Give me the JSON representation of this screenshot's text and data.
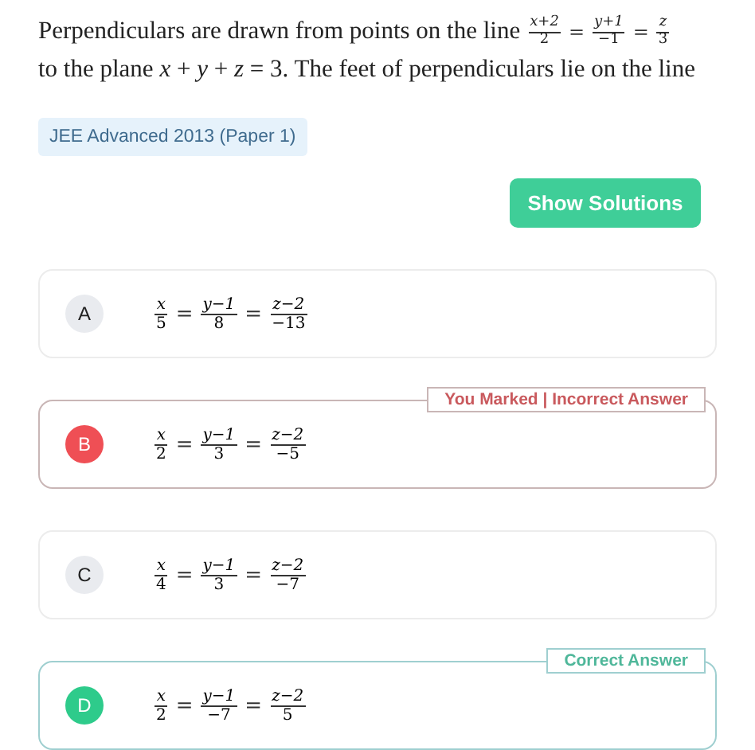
{
  "question": {
    "line_1": "Perpendiculars are drawn from points on the line",
    "line_1_equation": {
      "sign": "=",
      "fractions": [
        {
          "num": "x+2",
          "den": "2"
        },
        {
          "num": "y+1",
          "den": "−1"
        },
        {
          "num": "z",
          "den": "3"
        }
      ]
    },
    "line_2": "to the plane *x* + *y* + *z* = 3. The feet of perpendiculars lie on the line"
  },
  "tag": "JEE Advanced 2013 (Paper 1)",
  "show_solutions_button": "Show Solutions",
  "options": [
    {
      "letter": "A",
      "marked": false,
      "correct": false,
      "equation": {
        "sign": "=",
        "fractions": [
          {
            "num": "x",
            "den": "5"
          },
          {
            "num": "y−1",
            "den": "8"
          },
          {
            "num": "z−2",
            "den": "−13"
          }
        ]
      }
    },
    {
      "letter": "B",
      "marked": true,
      "correct": false,
      "badge": "You Marked | Incorrect Answer",
      "equation": {
        "sign": "=",
        "fractions": [
          {
            "num": "x",
            "den": "2"
          },
          {
            "num": "y−1",
            "den": "3"
          },
          {
            "num": "z−2",
            "den": "−5"
          }
        ]
      }
    },
    {
      "letter": "C",
      "marked": false,
      "correct": false,
      "equation": {
        "sign": "=",
        "fractions": [
          {
            "num": "x",
            "den": "4"
          },
          {
            "num": "y−1",
            "den": "3"
          },
          {
            "num": "z−2",
            "den": "−7"
          }
        ]
      }
    },
    {
      "letter": "D",
      "marked": false,
      "correct": true,
      "badge": "Correct Answer",
      "equation": {
        "sign": "=",
        "fractions": [
          {
            "num": "x",
            "den": "2"
          },
          {
            "num": "y−1",
            "den": "−7"
          },
          {
            "num": "z−2",
            "den": "5"
          }
        ]
      }
    }
  ]
}
